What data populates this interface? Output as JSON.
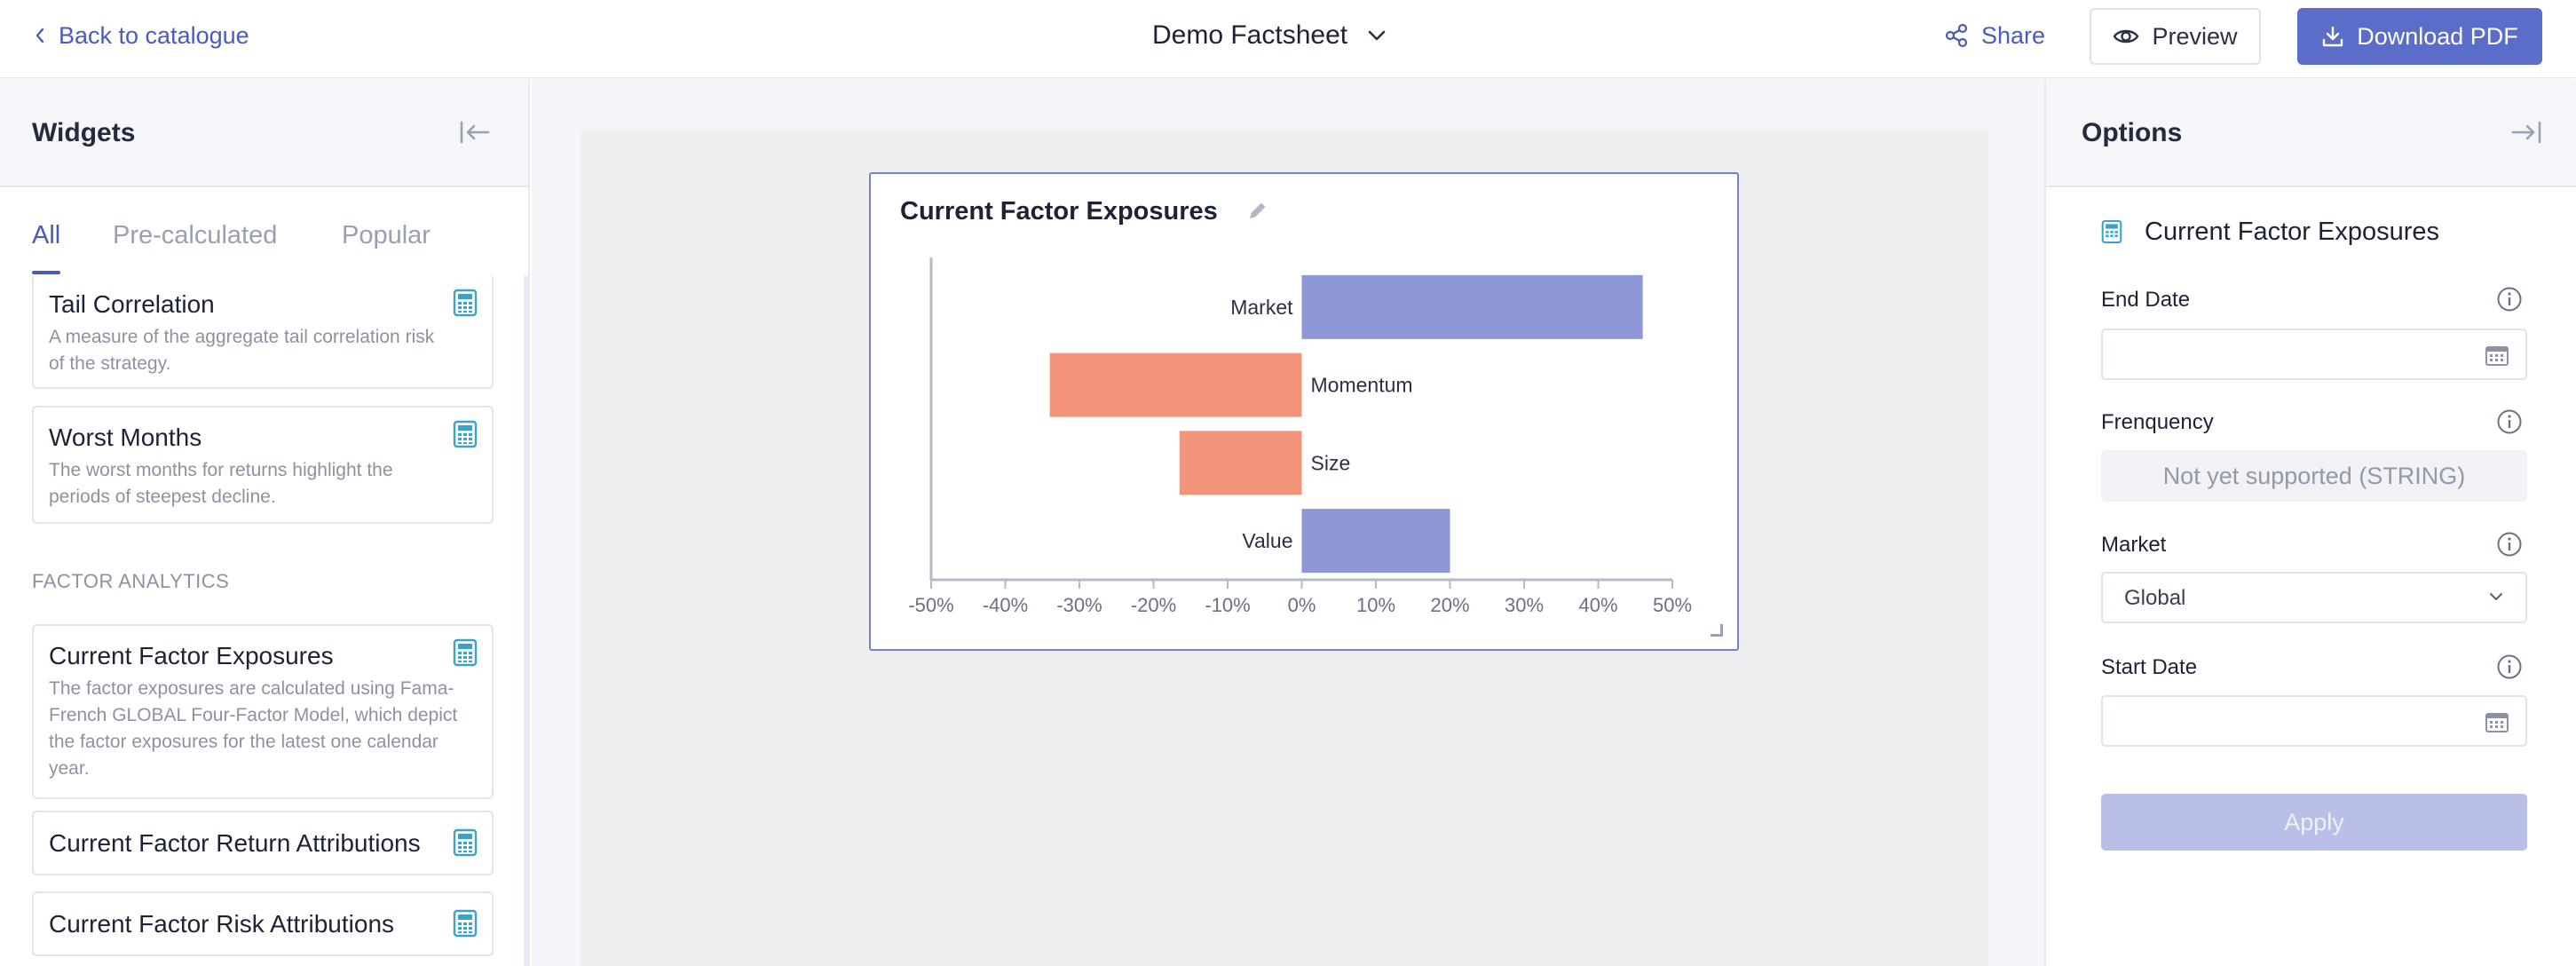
{
  "header": {
    "back_label": "Back to catalogue",
    "document_title": "Demo Factsheet",
    "share_label": "Share",
    "preview_label": "Preview",
    "download_label": "Download PDF"
  },
  "widgets_panel": {
    "title": "Widgets",
    "tabs": [
      {
        "label": "All",
        "active": true
      },
      {
        "label": "Pre-calculated",
        "active": false
      },
      {
        "label": "Popular",
        "active": false
      }
    ],
    "cards": [
      {
        "title": "Tail Correlation",
        "description": "A measure of the aggregate tail correlation risk of the strategy.",
        "icon": "calculator-icon"
      },
      {
        "title": "Worst Months",
        "description": "The worst months for returns highlight the periods of steepest decline.",
        "icon": "calculator-icon"
      },
      {
        "title": "Current Factor Exposures",
        "description": "The factor exposures are calculated using Fama-French GLOBAL Four-Factor Model, which depict the factor exposures for the latest one calendar year.",
        "icon": "calculator-icon"
      },
      {
        "title": "Current Factor Return Attributions",
        "description": "",
        "icon": "calculator-icon"
      },
      {
        "title": "Current Factor Risk Attributions",
        "description": "",
        "icon": "calculator-icon"
      }
    ],
    "section_label": "FACTOR ANALYTICS"
  },
  "widget": {
    "title": "Current Factor Exposures"
  },
  "chart_data": {
    "type": "bar",
    "orientation": "horizontal",
    "categories": [
      "Market",
      "Momentum",
      "Size",
      "Value"
    ],
    "values": [
      46,
      -34,
      -16.5,
      20
    ],
    "xlim": [
      -50,
      50
    ],
    "x_ticks": [
      "-50%",
      "-40%",
      "-30%",
      "-20%",
      "-10%",
      "0%",
      "10%",
      "20%",
      "30%",
      "40%",
      "50%"
    ],
    "positive_color": "#8e97d6",
    "negative_color": "#f2947a",
    "title": "",
    "xlabel": "",
    "ylabel": ""
  },
  "options_panel": {
    "title": "Options",
    "widget_name": "Current Factor Exposures",
    "fields": {
      "end_date_label": "End Date",
      "frequency_label": "Frenquency",
      "frequency_value": "Not yet supported (STRING)",
      "market_label": "Market",
      "market_value": "Global",
      "start_date_label": "Start Date"
    },
    "apply_label": "Apply"
  },
  "colors": {
    "accent": "#5b6cc9",
    "link": "#4a5bbd",
    "icon_teal": "#3aa3c8"
  }
}
